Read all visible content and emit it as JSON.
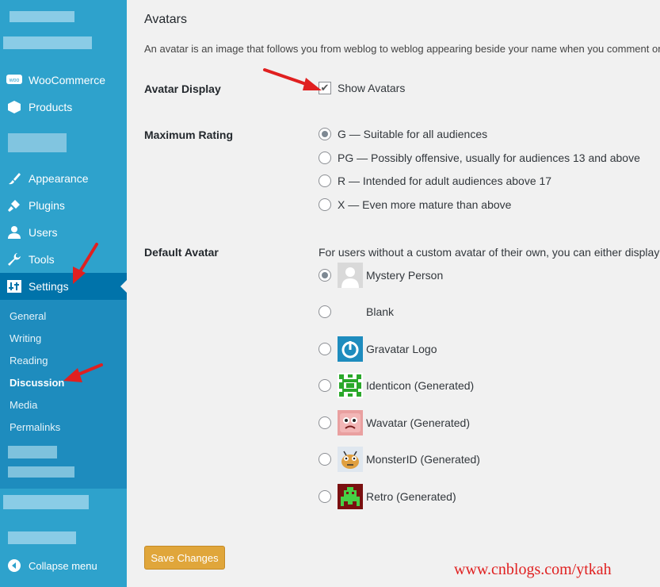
{
  "sidebar": {
    "items": [
      {
        "label": "WooCommerce",
        "icon": "woocommerce-icon"
      },
      {
        "label": "Products",
        "icon": "products-icon"
      },
      {
        "label": "Appearance",
        "icon": "paintbrush-icon"
      },
      {
        "label": "Plugins",
        "icon": "plugin-icon"
      },
      {
        "label": "Users",
        "icon": "users-icon"
      },
      {
        "label": "Tools",
        "icon": "wrench-icon"
      },
      {
        "label": "Settings",
        "icon": "settings-icon"
      }
    ],
    "submenu": [
      "General",
      "Writing",
      "Reading",
      "Discussion",
      "Media",
      "Permalinks"
    ],
    "collapse_label": "Collapse menu"
  },
  "main": {
    "section_title": "Avatars",
    "description": "An avatar is an image that follows you from weblog to weblog appearing beside your name when you comment on",
    "avatar_display": {
      "label": "Avatar Display",
      "checkbox_label": "Show Avatars",
      "checked": true
    },
    "max_rating": {
      "label": "Maximum Rating",
      "options": [
        "G — Suitable for all audiences",
        "PG — Possibly offensive, usually for audiences 13 and above",
        "R — Intended for adult audiences above 17",
        "X — Even more mature than above"
      ],
      "selected": 0
    },
    "default_avatar": {
      "label": "Default Avatar",
      "description": "For users without a custom avatar of their own, you can either display",
      "options": [
        "Mystery Person",
        "Blank",
        "Gravatar Logo",
        "Identicon (Generated)",
        "Wavatar (Generated)",
        "MonsterID (Generated)",
        "Retro (Generated)"
      ],
      "selected": 0
    },
    "save_label": "Save Changes"
  },
  "watermark": "www.cnblogs.com/ytkah",
  "colors": {
    "sidebar": "#2ea2cc",
    "sidebar_current": "#0073aa",
    "submenu": "#1e8cbe",
    "save_button": "#e0a63b",
    "arrow": "#e02020"
  }
}
